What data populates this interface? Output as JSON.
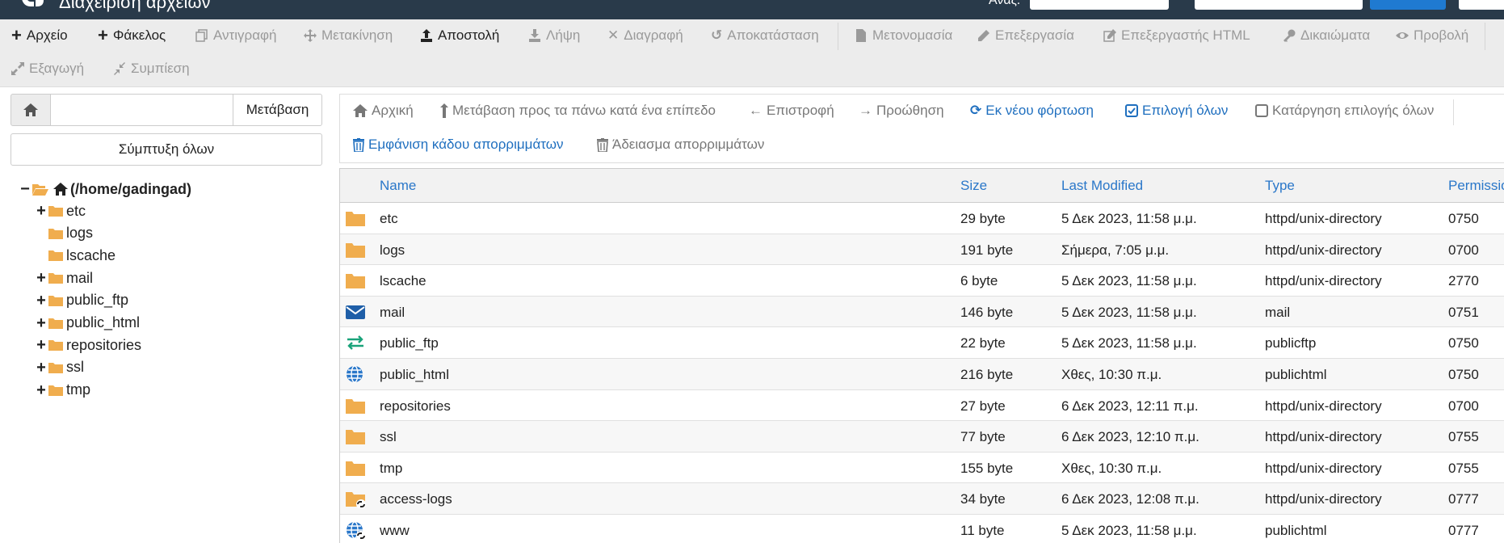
{
  "header": {
    "app_title": "Διαχείριση αρχείων",
    "search_label": "Αναζ."
  },
  "toolbar": {
    "file": "Αρχείο",
    "folder": "Φάκελος",
    "copy": "Αντιγραφή",
    "move": "Μετακίνηση",
    "upload": "Αποστολή",
    "download": "Λήψη",
    "delete": "Διαγραφή",
    "restore": "Αποκατάσταση",
    "rename": "Μετονομασία",
    "edit": "Επεξεργασία",
    "html_editor": "Επεξεργαστής HTML",
    "permissions": "Δικαιώματα",
    "view": "Προβολή",
    "extract": "Εξαγωγή",
    "compress": "Συμπίεση"
  },
  "nav": {
    "path_value": "",
    "go_label": "Μετάβαση",
    "collapse_label": "Σύμπτυξη όλων"
  },
  "tree": {
    "root": "(/home/gadingad)",
    "items": [
      {
        "name": "etc",
        "expandable": true
      },
      {
        "name": "logs",
        "expandable": false
      },
      {
        "name": "lscache",
        "expandable": false
      },
      {
        "name": "mail",
        "expandable": true
      },
      {
        "name": "public_ftp",
        "expandable": true
      },
      {
        "name": "public_html",
        "expandable": true
      },
      {
        "name": "repositories",
        "expandable": true
      },
      {
        "name": "ssl",
        "expandable": true
      },
      {
        "name": "tmp",
        "expandable": true
      }
    ]
  },
  "actions": {
    "home": "Αρχική",
    "up_one_level": "Μετάβαση προς τα πάνω κατά ένα επίπεδο",
    "back": "Επιστροφή",
    "forward": "Προώθηση",
    "reload": "Εκ νέου φόρτωση",
    "select_all": "Επιλογή όλων",
    "unselect_all": "Κατάργηση επιλογής όλων",
    "view_trash": "Εμφάνιση κάδου απορριμμάτων",
    "empty_trash": "Άδειασμα απορριμμάτων"
  },
  "table": {
    "columns": {
      "name": "Name",
      "size": "Size",
      "modified": "Last Modified",
      "type": "Type",
      "perms": "Permissions"
    },
    "rows": [
      {
        "icon": "folder-icon",
        "name": "etc",
        "size": "29 byte",
        "modified": "5 Δεκ 2023, 11:58 μ.μ.",
        "type": "httpd/unix-directory",
        "perms": "0750"
      },
      {
        "icon": "folder-icon",
        "name": "logs",
        "size": "191 byte",
        "modified": "Σήμερα, 7:05 μ.μ.",
        "type": "httpd/unix-directory",
        "perms": "0700"
      },
      {
        "icon": "folder-icon",
        "name": "lscache",
        "size": "6 byte",
        "modified": "5 Δεκ 2023, 11:58 μ.μ.",
        "type": "httpd/unix-directory",
        "perms": "2770"
      },
      {
        "icon": "envelope-icon",
        "name": "mail",
        "size": "146 byte",
        "modified": "5 Δεκ 2023, 11:58 μ.μ.",
        "type": "mail",
        "perms": "0751"
      },
      {
        "icon": "transfer-icon",
        "name": "public_ftp",
        "size": "22 byte",
        "modified": "5 Δεκ 2023, 11:58 μ.μ.",
        "type": "publicftp",
        "perms": "0750"
      },
      {
        "icon": "globe-icon",
        "name": "public_html",
        "size": "216 byte",
        "modified": "Χθες, 10:30 π.μ.",
        "type": "publichtml",
        "perms": "0750"
      },
      {
        "icon": "folder-icon",
        "name": "repositories",
        "size": "27 byte",
        "modified": "6 Δεκ 2023, 12:11 π.μ.",
        "type": "httpd/unix-directory",
        "perms": "0700"
      },
      {
        "icon": "folder-icon",
        "name": "ssl",
        "size": "77 byte",
        "modified": "6 Δεκ 2023, 12:10 π.μ.",
        "type": "httpd/unix-directory",
        "perms": "0755"
      },
      {
        "icon": "folder-icon",
        "name": "tmp",
        "size": "155 byte",
        "modified": "Χθες, 10:30 π.μ.",
        "type": "httpd/unix-directory",
        "perms": "0755"
      },
      {
        "icon": "folder-link-icon",
        "name": "access-logs",
        "size": "34 byte",
        "modified": "6 Δεκ 2023, 12:08 π.μ.",
        "type": "httpd/unix-directory",
        "perms": "0777"
      },
      {
        "icon": "globe-link-icon",
        "name": "www",
        "size": "11 byte",
        "modified": "5 Δεκ 2023, 11:58 μ.μ.",
        "type": "publichtml",
        "perms": "0777"
      }
    ]
  },
  "colors": {
    "header_bg": "#293a4a",
    "link_blue": "#2a77c9",
    "folder_yellow": "#f0ad4e",
    "mail_blue": "#1f5fa8",
    "ftp_green": "#1aa37a",
    "globe_blue": "#2a77c9"
  }
}
